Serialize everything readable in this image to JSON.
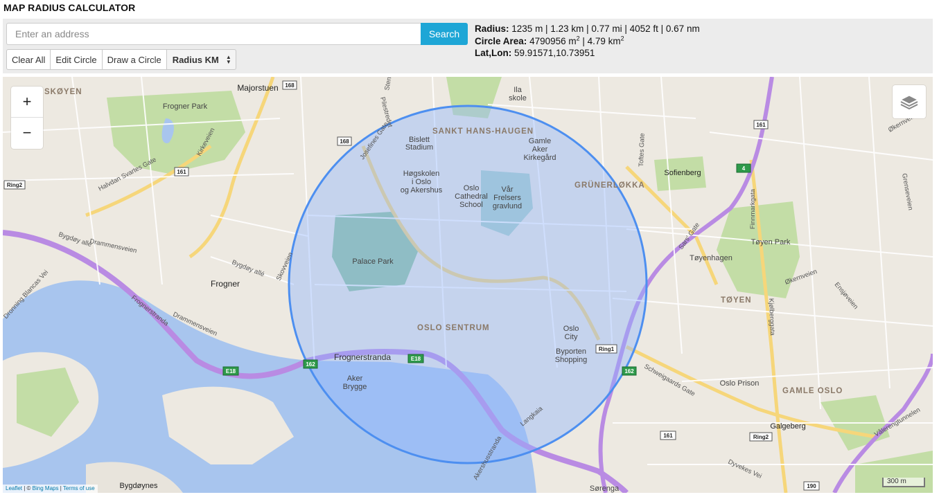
{
  "app": {
    "title": "MAP RADIUS CALCULATOR"
  },
  "search": {
    "placeholder": "Enter an address",
    "value": "",
    "button_label": "Search"
  },
  "toolbar": {
    "clear_all_label": "Clear All",
    "edit_circle_label": "Edit Circle",
    "draw_circle_label": "Draw a Circle",
    "radius_unit_selected": "Radius KM"
  },
  "info": {
    "radius_label": "Radius:",
    "radius_value": "1235 m | 1.23 km | 0.77 mi | 4052 ft | 0.67 nm",
    "area_label": "Circle Area:",
    "area_m2": "4790956 m",
    "area_sep": " | 4.79 km",
    "sup": "2",
    "latlon_label": "Lat,Lon:",
    "latlon_value": "59.91571,10.73951"
  },
  "map": {
    "zoom_in": "+",
    "zoom_out": "−",
    "layers_icon": "layers-icon",
    "circle_color": "#4d8ff0",
    "scale_label": "300 m",
    "attribution": {
      "leaflet": "Leaflet",
      "sep1": " | © ",
      "bing": "Bing Maps",
      "sep2": " | ",
      "terms": "Terms of use"
    },
    "labels": {
      "skoyen": "SKØYEN",
      "majorstuen": "Majorstuen",
      "frogner_park": "Frogner Park",
      "kirkeveien": "Kirkeveien",
      "halvdan": "Halvdan Svartes Gate",
      "ring2_left": "Ring2",
      "r168a": "168",
      "r168b": "168",
      "r161a": "161",
      "bislett": "Bislett",
      "stadium": "Stadium",
      "sankt": "SANKT HANS-HAUGEN",
      "gamle1": "Gamle",
      "gamle2": "Aker",
      "gamle3": "Kirkegård",
      "ila1": "Ila",
      "ila2": "skole",
      "hogs1": "Høgskolen",
      "hogs2": "i Oslo",
      "hogs3": "og Akershus",
      "cath1": "Oslo",
      "cath2": "Cathedral",
      "cath3": "School",
      "var1": "Vår",
      "var2": "Frelsers",
      "var3": "gravlund",
      "grunerlokka": "GRÜNERLØKKA",
      "sofienberg": "Sofienberg",
      "r161b": "161",
      "r4": "4",
      "finnmark": "Finnmarkgata",
      "sars": "Sars' Gate",
      "toyen_park": "Tøyen Park",
      "toyenhagen": "Tøyenhagen",
      "toyen": "TØYEN",
      "kjolberg": "Kjølberggata",
      "bygdoy_alle": "Bygdøy allé",
      "drammens": "Drammensveien",
      "palace_park": "Palace Park",
      "frogner": "Frogner",
      "skovveien": "Skovveien",
      "dronning": "Dronning Blancas Vei",
      "frognerstranda_road": "Frognerstranda",
      "drammens2": "Drammensveien",
      "oslo_sentrum": "OSLO SENTRUM",
      "oslo_city1": "Oslo",
      "oslo_city2": "City",
      "byporten1": "Byporten",
      "byporten2": "Shopping",
      "ring1": "Ring1",
      "r162a": "162",
      "r162b": "162",
      "e18": "E18",
      "e18r": "E18",
      "frognerstranda": "Frognerstranda",
      "aker1": "Aker",
      "aker2": "Brygge",
      "langkaia": "Langkaia",
      "akershus": "Akershusstranda",
      "schweigaard": "Schweigaards Gate",
      "oslo_prison": "Oslo Prison",
      "gamle_oslo": "GAMLE OSLO",
      "galgeberg": "Galgeberg",
      "ring2_right": "Ring2",
      "r161c": "161",
      "valerenga": "Vålerengtunnelen",
      "dyvekes": "Dyvekes Vei",
      "r190": "190",
      "sorenga": "Sørenga",
      "bygdoynes": "Bygdøynes",
      "bygdoy_alle2": "Bygdøy allé",
      "okernveien": "Økernveien",
      "okern2": "Økernveien",
      "grenseveien": "Grenseveien",
      "ensjo": "Ensjøveien",
      "toftes": "Toftes Gate",
      "josefines": "Josefines Gate",
      "pilestredet": "Pilestredet",
      "stensberg": "Stensberg"
    }
  }
}
